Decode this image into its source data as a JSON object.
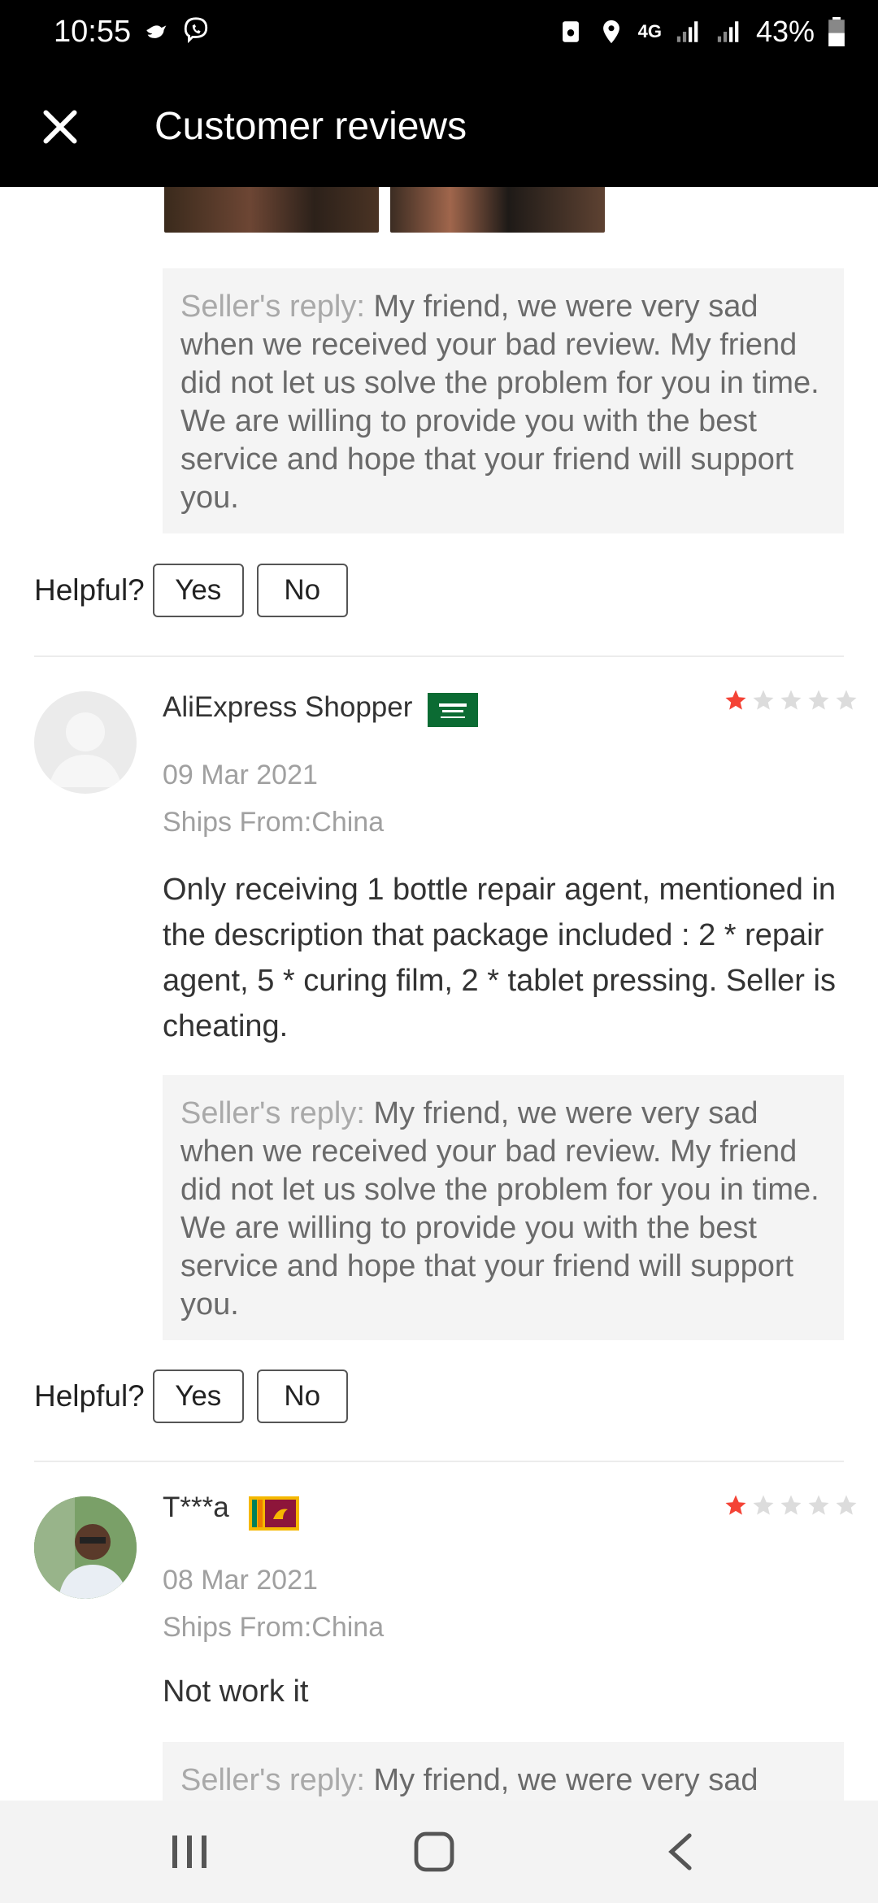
{
  "status_bar": {
    "time": "10:55",
    "battery": "43%",
    "network": "4G"
  },
  "app_bar": {
    "title": "Customer reviews"
  },
  "top_reply": {
    "prefix": "Seller's reply:",
    "text": " My friend, we were very sad when we received your bad review. My friend did not let us solve the problem for you in time. We are willing to provide you with the best service and hope that your friend will support you."
  },
  "helpful": {
    "label": "Helpful?",
    "yes": "Yes",
    "no": "No"
  },
  "reviews": [
    {
      "name": "AliExpress Shopper",
      "country_flag": "saudi-arabia",
      "rating": 1,
      "date": "09 Mar 2021",
      "ships_from": "Ships From:China",
      "text": "Only receiving 1 bottle repair agent, mentioned in the description that package included : 2 * repair agent, 5 * curing film, 2 * tablet pressing. Seller is cheating.",
      "reply_prefix": "Seller's reply:",
      "reply_text": " My friend, we were very sad when we received your bad review. My friend did not let us solve the problem for you in time. We are willing to provide you with the best service and hope that your friend will support you."
    },
    {
      "name": "T***a",
      "country_flag": "sri-lanka",
      "rating": 1,
      "date": "08 Mar 2021",
      "ships_from": "Ships From:China",
      "text": "Not work it",
      "reply_prefix": "Seller's reply:",
      "reply_text": " My friend, we were very sad"
    }
  ],
  "colors": {
    "star_filled": "#f44336",
    "star_empty": "#dcdcdc",
    "reply_bg": "#f4f4f4"
  }
}
